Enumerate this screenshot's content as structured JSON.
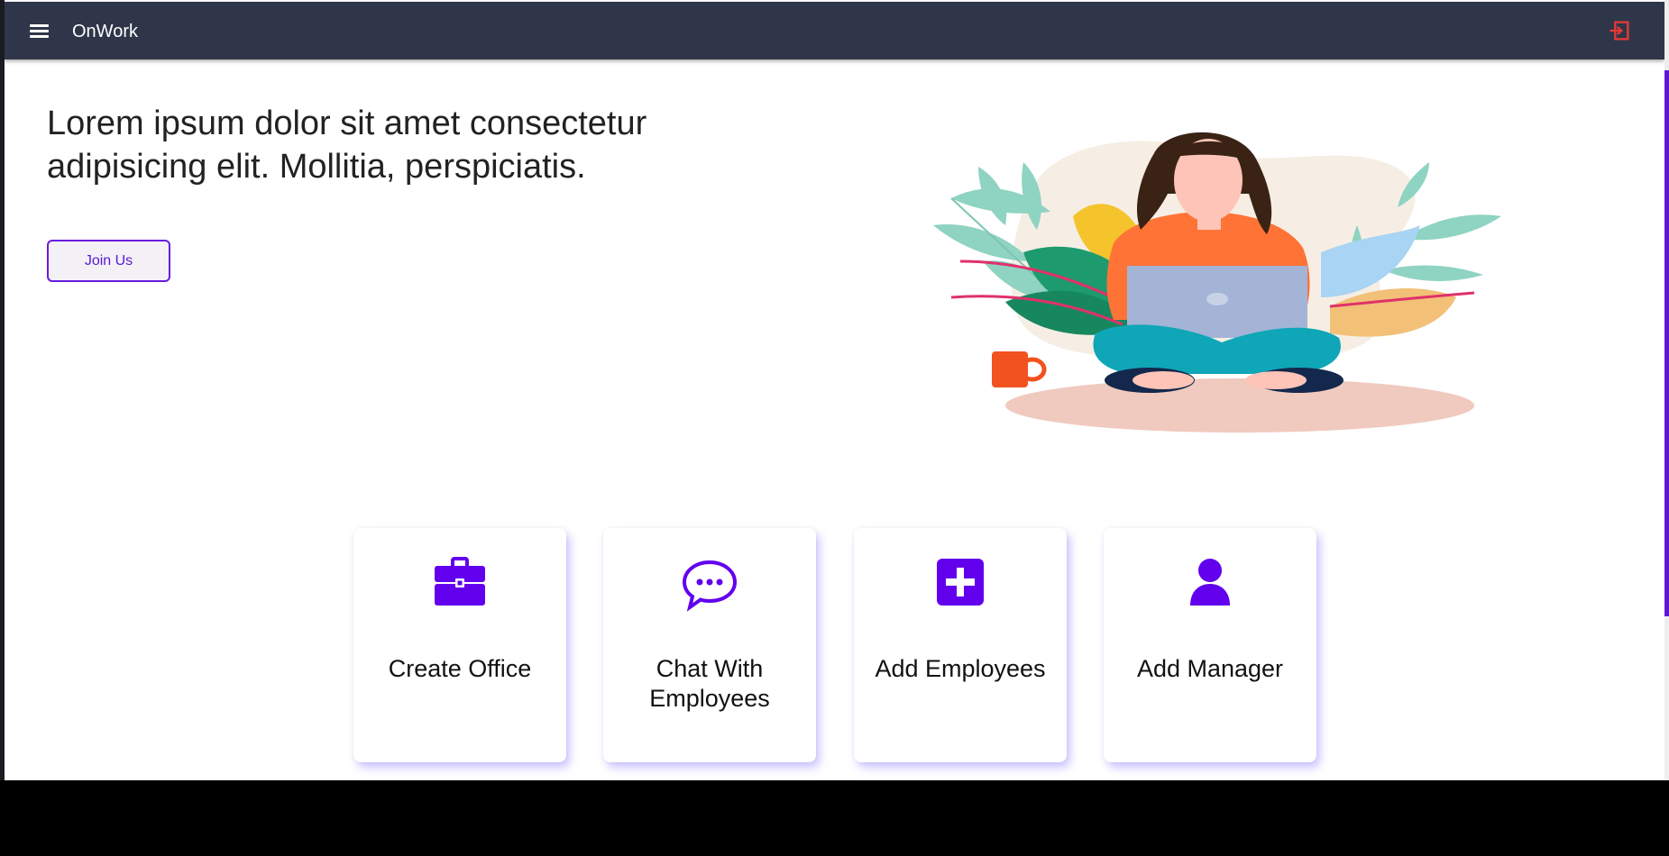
{
  "header": {
    "brand": "OnWork",
    "menu_icon": "hamburger-menu-icon",
    "logout_icon": "logout-icon"
  },
  "hero": {
    "title": "Lorem ipsum dolor sit amet consectetur adipisicing elit. Mollitia, perspiciatis.",
    "join_label": "Join Us"
  },
  "cards": [
    {
      "label": "Create Office",
      "icon": "briefcase-icon"
    },
    {
      "label": "Chat With Employees",
      "icon": "chat-bubble-icon"
    },
    {
      "label": "Add Employees",
      "icon": "plus-square-icon"
    },
    {
      "label": "Add Manager",
      "icon": "user-icon"
    }
  ],
  "colors": {
    "topbar": "#2f3649",
    "accent": "#6200ee",
    "logout": "#e53935"
  }
}
